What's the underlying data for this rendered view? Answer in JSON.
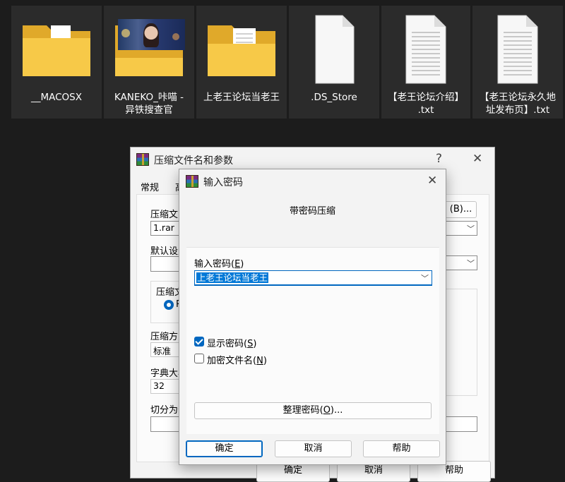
{
  "desktop": {
    "files": [
      {
        "label": "__MACOSX",
        "icon": "folder-icon"
      },
      {
        "label": "KANEKO_咔喵 -\n异铁搜查官",
        "icon": "folder-photo-icon"
      },
      {
        "label": "上老王论坛当老王",
        "icon": "folder-icon"
      },
      {
        "label": ".DS_Store",
        "icon": "blank-file-icon"
      },
      {
        "label": "【老王论坛介绍】\n.txt",
        "icon": "text-file-icon"
      },
      {
        "label": "【老王论坛永久地\n址发布页】.txt",
        "icon": "text-file-icon"
      }
    ]
  },
  "archive_dialog": {
    "title": "压缩文件名和参数",
    "help": "?",
    "close": "✕",
    "tab_general": "常规",
    "tab_partial": "高",
    "archive_name_label": "压缩文",
    "archive_name_value": "1.rar",
    "browse_label": "(B)...",
    "default_settings_label": "默认设置",
    "format_group_label": "压缩文",
    "format_radio_partial": "R",
    "method_label": "压缩方",
    "method_value": "标准",
    "dict_label": "字典大小",
    "dict_value": "32",
    "split_label": "切分为分",
    "ok": "确定",
    "cancel": "取消",
    "help_btn": "帮助"
  },
  "password_dialog": {
    "title": "输入密码",
    "close": "✕",
    "heading": "带密码压缩",
    "enter_label": "输入密码(",
    "enter_key": "E",
    "enter_label_end": ")",
    "password_value": "上老王论坛当老王",
    "show_password_label": "显示密码(",
    "show_password_key": "S",
    "show_password_end": ")",
    "show_password_checked": true,
    "encrypt_names_label": "加密文件名(",
    "encrypt_names_key": "N",
    "encrypt_names_end": ")",
    "encrypt_names_checked": false,
    "organize_label": "整理密码(",
    "organize_key": "O",
    "organize_end": ")...",
    "ok": "确定",
    "cancel": "取消",
    "help": "帮助"
  },
  "colors": {
    "accent": "#0067c0",
    "selection": "#0078d7",
    "folder": "#f5c542",
    "background": "#1c1c1c"
  }
}
